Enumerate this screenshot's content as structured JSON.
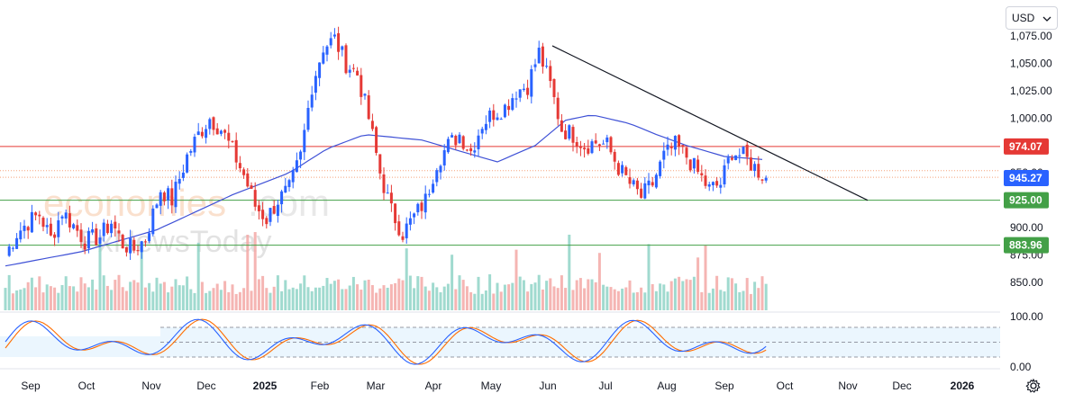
{
  "currency": {
    "label": "USD",
    "icon": "chevron-down-icon"
  },
  "settings": {
    "icon": "gear-icon"
  },
  "watermark": {
    "brand": "economies",
    "brand_suffix": ".com",
    "sub": "FxNewsToday"
  },
  "chart_data": {
    "type": "candlestick",
    "price_axis": {
      "ticks": [
        1075,
        1050,
        1025,
        1000,
        950,
        900,
        875,
        850
      ],
      "tick_labels": [
        "1,075.00",
        "1,050.00",
        "1,025.00",
        "1,000.00",
        "950.00",
        "900.00",
        "875.00",
        "850.00"
      ],
      "range": [
        827,
        1082
      ]
    },
    "time_axis": {
      "labels": [
        "Sep",
        "Oct",
        "Nov",
        "Dec",
        "2025",
        "Feb",
        "Mar",
        "Apr",
        "May",
        "Jun",
        "Jul",
        "Aug",
        "Sep",
        "Oct",
        "Nov",
        "Dec",
        "2026"
      ],
      "bold": [
        "2025",
        "2026"
      ]
    },
    "price_lines": [
      {
        "value": 974.07,
        "label": "974.07",
        "color": "#e53935"
      },
      {
        "value": 925.0,
        "label": "925.00",
        "color": "#43a047"
      },
      {
        "value": 883.96,
        "label": "883.96",
        "color": "#43a047"
      }
    ],
    "last_price": {
      "value": 945.27,
      "label": "945.27",
      "color": "#2962ff"
    },
    "trendline": {
      "from": {
        "date": "Jun 2025",
        "value": 1066
      },
      "to": {
        "date": "Oct 2025",
        "value": 925
      }
    },
    "price_path": [
      [
        0,
        875
      ],
      [
        3,
        895
      ],
      [
        6,
        905
      ],
      [
        9,
        912
      ],
      [
        12,
        890
      ],
      [
        15,
        915
      ],
      [
        18,
        902
      ],
      [
        21,
        888
      ],
      [
        25,
        892
      ],
      [
        28,
        905
      ],
      [
        31,
        885
      ],
      [
        34,
        880
      ],
      [
        37,
        890
      ],
      [
        41,
        935
      ],
      [
        44,
        925
      ],
      [
        48,
        965
      ],
      [
        51,
        985
      ],
      [
        54,
        1000
      ],
      [
        57,
        990
      ],
      [
        60,
        970
      ],
      [
        63,
        948
      ],
      [
        66,
        920
      ],
      [
        69,
        908
      ],
      [
        72,
        925
      ],
      [
        75,
        935
      ],
      [
        78,
        965
      ],
      [
        81,
        1030
      ],
      [
        84,
        1065
      ],
      [
        87,
        1072
      ],
      [
        90,
        1050
      ],
      [
        93,
        1040
      ],
      [
        96,
        1000
      ],
      [
        99,
        950
      ],
      [
        102,
        915
      ],
      [
        105,
        895
      ],
      [
        108,
        910
      ],
      [
        111,
        925
      ],
      [
        114,
        960
      ],
      [
        117,
        975
      ],
      [
        120,
        985
      ],
      [
        123,
        970
      ],
      [
        126,
        995
      ],
      [
        129,
        1005
      ],
      [
        132,
        1010
      ],
      [
        135,
        1025
      ],
      [
        138,
        1030
      ],
      [
        141,
        1060
      ],
      [
        144,
        1030
      ],
      [
        147,
        990
      ],
      [
        150,
        985
      ],
      [
        153,
        975
      ],
      [
        156,
        978
      ],
      [
        159,
        975
      ],
      [
        162,
        955
      ],
      [
        165,
        940
      ],
      [
        168,
        928
      ],
      [
        171,
        940
      ],
      [
        174,
        965
      ],
      [
        177,
        975
      ],
      [
        180,
        965
      ],
      [
        183,
        950
      ],
      [
        186,
        935
      ],
      [
        189,
        940
      ],
      [
        192,
        970
      ],
      [
        195,
        965
      ],
      [
        198,
        955
      ],
      [
        201,
        945
      ]
    ],
    "sma": [
      [
        0,
        865
      ],
      [
        20,
        878
      ],
      [
        40,
        898
      ],
      [
        60,
        930
      ],
      [
        75,
        950
      ],
      [
        85,
        972
      ],
      [
        95,
        985
      ],
      [
        110,
        980
      ],
      [
        120,
        970
      ],
      [
        130,
        960
      ],
      [
        140,
        975
      ],
      [
        148,
        998
      ],
      [
        155,
        1003
      ],
      [
        165,
        995
      ],
      [
        172,
        985
      ],
      [
        180,
        975
      ],
      [
        190,
        965
      ],
      [
        201,
        962
      ]
    ],
    "stochastic_rsi": {
      "levels": {
        "upper": 80,
        "lower": 20,
        "axis": [
          "100.00",
          "0.00"
        ]
      },
      "k_color": "#2962ff",
      "d_color": "#ff6d00"
    }
  }
}
